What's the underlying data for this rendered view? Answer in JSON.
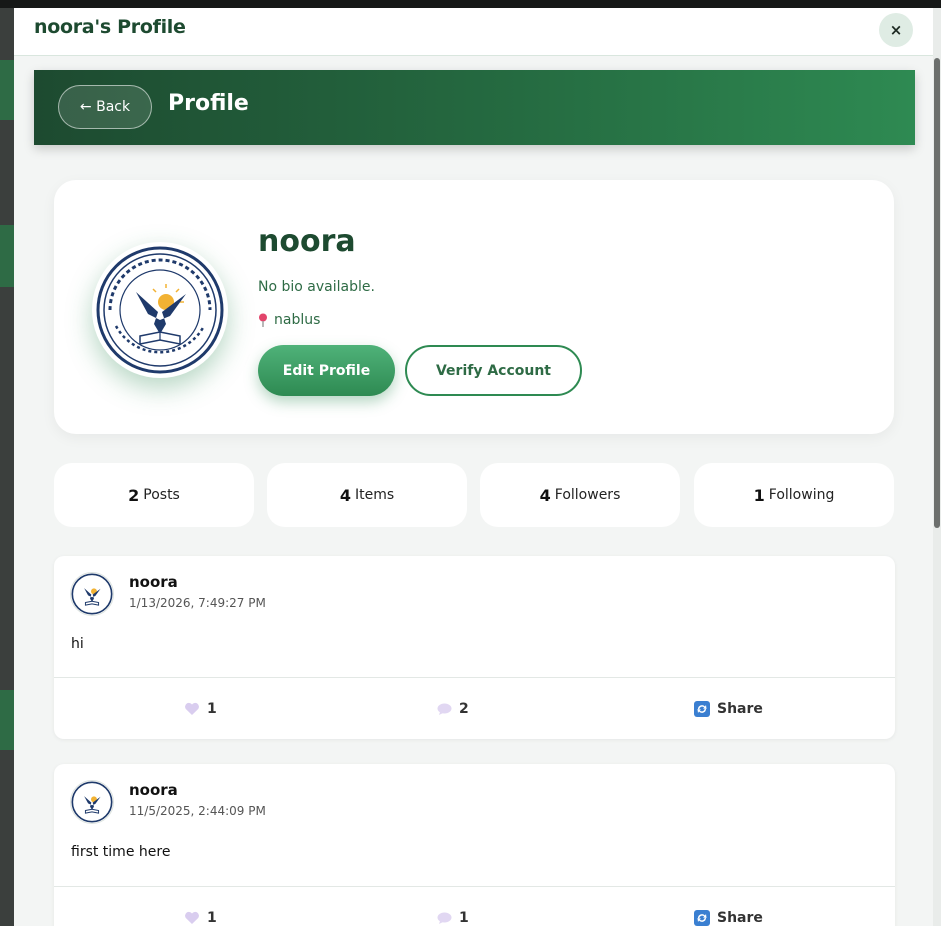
{
  "modal": {
    "title": "noora's Profile",
    "close_label": "×"
  },
  "hero": {
    "back_label": "← Back",
    "title": "Profile"
  },
  "profile": {
    "username": "noora",
    "bio": "No bio available.",
    "location": "nablus",
    "edit_label": "Edit Profile",
    "verify_label": "Verify Account"
  },
  "stats": [
    {
      "count": "2",
      "label": "Posts"
    },
    {
      "count": "4",
      "label": "Items"
    },
    {
      "count": "4",
      "label": "Followers"
    },
    {
      "count": "1",
      "label": "Following"
    }
  ],
  "posts": [
    {
      "author": "noora",
      "time": "1/13/2026, 7:49:27 PM",
      "content": "hi",
      "likes": "1",
      "comments": "2",
      "share_label": "Share"
    },
    {
      "author": "noora",
      "time": "11/5/2025, 2:44:09 PM",
      "content": "first time here",
      "likes": "1",
      "comments": "1",
      "share_label": "Share"
    }
  ],
  "colors": {
    "brand_dark": "#1d4a30",
    "brand": "#2e8a52",
    "pin": "#e2456b",
    "share": "#3a7fd1"
  },
  "icons": [
    "close-icon",
    "back-arrow-icon",
    "location-pin-icon",
    "heart-icon",
    "comment-icon",
    "share-icon",
    "university-seal-icon"
  ]
}
